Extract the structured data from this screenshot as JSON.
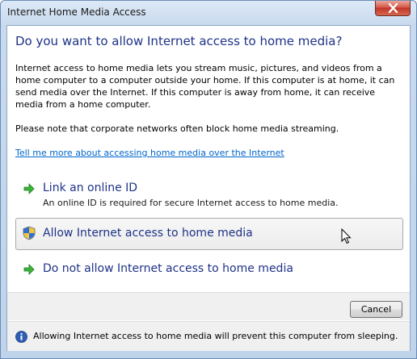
{
  "window": {
    "title": "Internet Home Media Access"
  },
  "dialog": {
    "heading": "Do you want to allow Internet access to home media?",
    "paragraph1": "Internet access to home media lets you stream music, pictures, and videos from a home computer to a computer outside your home.  If this computer is at home, it can send media over the Internet.  If this computer is away from home, it can receive media from a home computer.",
    "paragraph2": "Please note that corporate networks often block home media streaming.",
    "learn_more_link": "Tell me more about accessing home media over the Internet"
  },
  "options": [
    {
      "title": "Link an online ID",
      "description": "An online ID is required for secure Internet access to home media.",
      "icon": "green-arrow-icon"
    },
    {
      "title": "Allow Internet access to home media",
      "icon": "uac-shield-icon"
    },
    {
      "title": "Do not allow Internet access to home media",
      "icon": "green-arrow-icon"
    }
  ],
  "buttons": {
    "cancel": "Cancel"
  },
  "footer": {
    "text": "Allowing Internet access to home media will prevent this computer from sleeping.",
    "icon": "info-icon"
  },
  "colors": {
    "heading": "#1e3287",
    "link": "#0066cc",
    "arrow": "#3cb43c"
  }
}
